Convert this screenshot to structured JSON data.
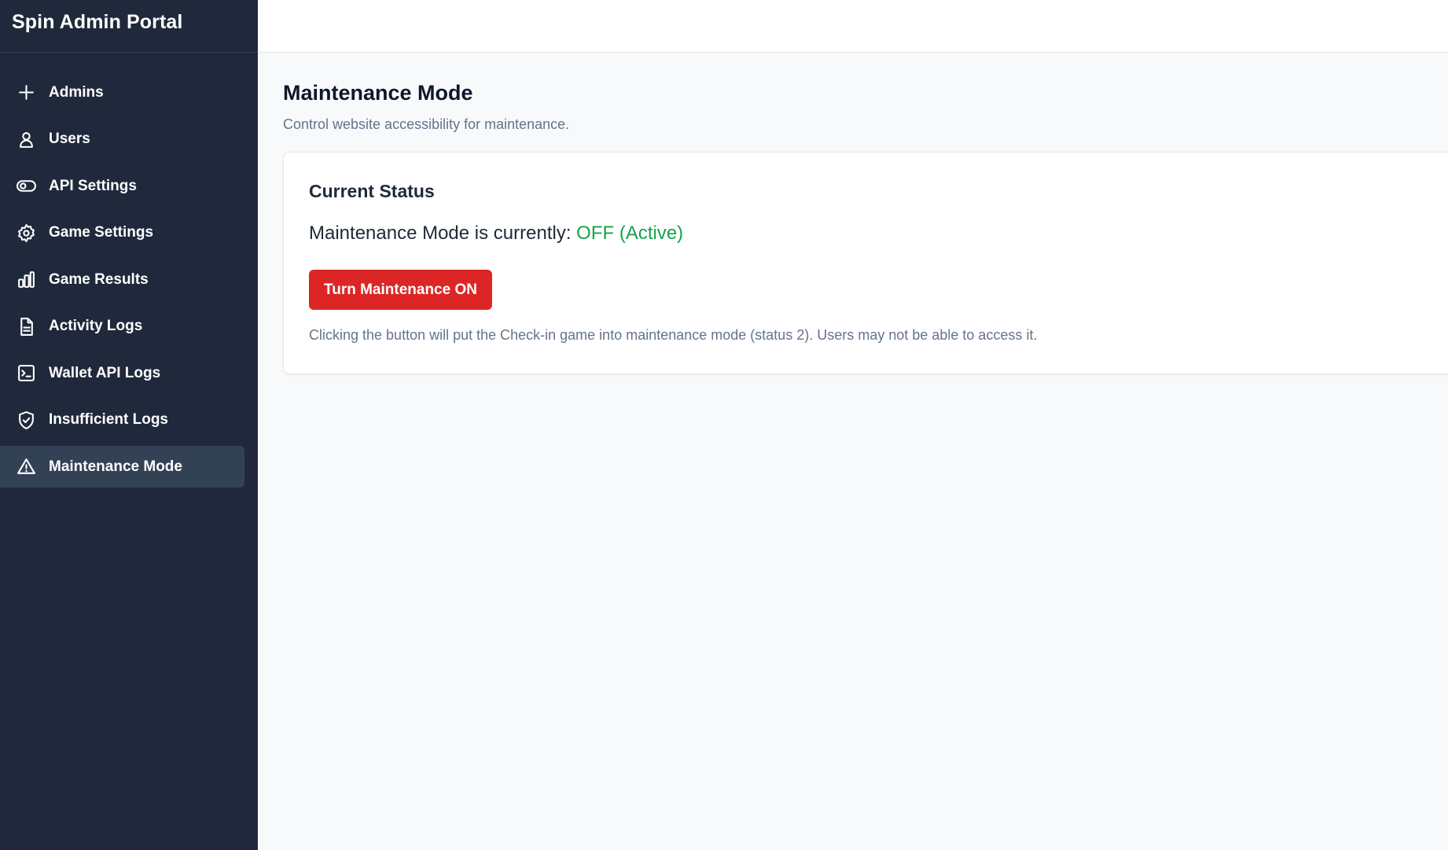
{
  "app": {
    "title": "Spin Admin Portal"
  },
  "sidebar": {
    "items": [
      {
        "label": "Admins",
        "icon": "plus-icon"
      },
      {
        "label": "Users",
        "icon": "user-icon"
      },
      {
        "label": "API Settings",
        "icon": "toggle-icon"
      },
      {
        "label": "Game Settings",
        "icon": "gear-icon"
      },
      {
        "label": "Game Results",
        "icon": "bar-chart-icon"
      },
      {
        "label": "Activity Logs",
        "icon": "document-icon"
      },
      {
        "label": "Wallet API Logs",
        "icon": "terminal-icon"
      },
      {
        "label": "Insufficient Logs",
        "icon": "shield-check-icon"
      },
      {
        "label": "Maintenance Mode",
        "icon": "warning-triangle-icon",
        "active": true
      }
    ]
  },
  "page": {
    "title": "Maintenance Mode",
    "subtitle": "Control website accessibility for maintenance."
  },
  "status_card": {
    "title": "Current Status",
    "status_prefix": "Maintenance Mode is currently: ",
    "status_value": "OFF (Active)",
    "status_color": "#16a34a",
    "button_label": "Turn Maintenance ON",
    "button_color": "#dc2626",
    "help_text": "Clicking the button will put the Check-in game into maintenance mode (status 2). Users may not be able to access it."
  }
}
